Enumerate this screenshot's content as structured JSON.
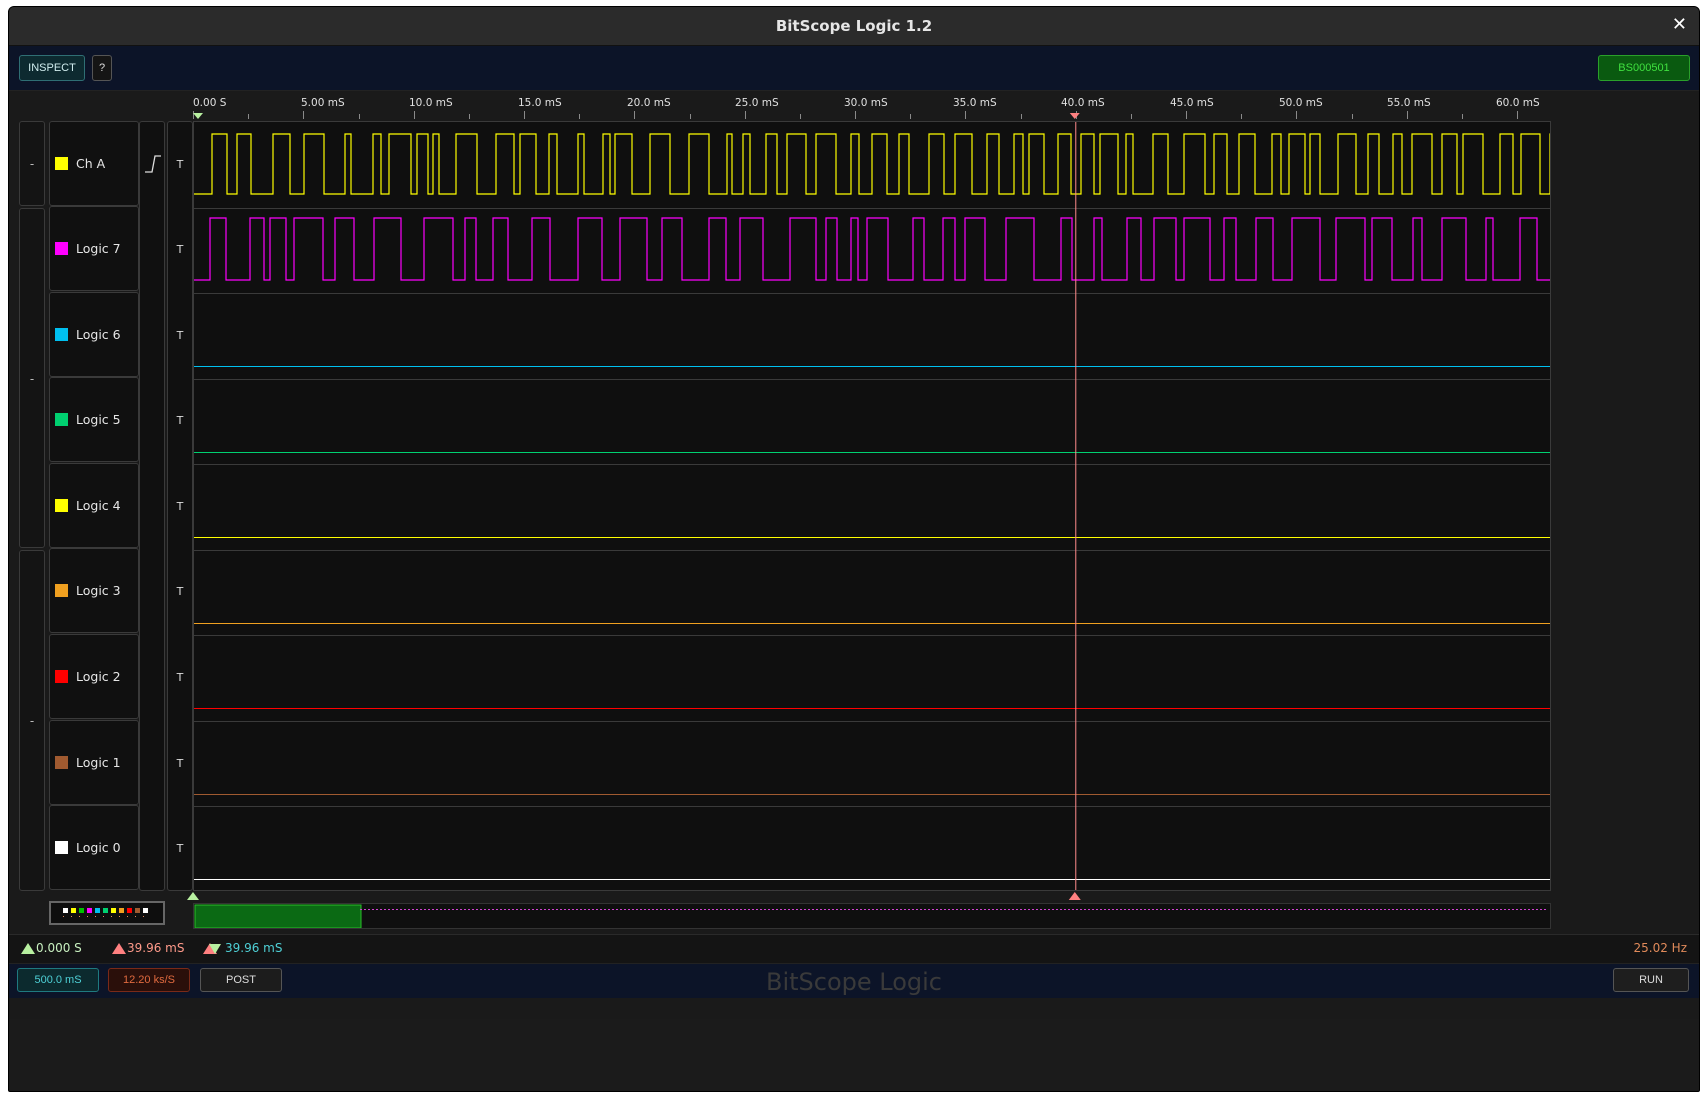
{
  "window": {
    "title": "BitScope Logic 1.2",
    "close_glyph": "✕"
  },
  "toolbar": {
    "inspect_label": "INSPECT",
    "help_label": "?",
    "device_label": "BS000501"
  },
  "ruler": {
    "ticks": [
      "0.00  S",
      "5.00 mS",
      "10.0 mS",
      "15.0 mS",
      "20.0 mS",
      "25.0 mS",
      "30.0 mS",
      "35.0 mS",
      "40.0 mS",
      "45.0 mS",
      "50.0 mS",
      "55.0 mS",
      "60.0 mS"
    ]
  },
  "groups": [
    "-",
    "-",
    "-"
  ],
  "channels": [
    {
      "name": "Ch A",
      "color": "#ffff00",
      "trigger": "T",
      "edge_icon": "rising-edge-icon"
    },
    {
      "name": "Logic 7",
      "color": "#ff00ff",
      "trigger": "T"
    },
    {
      "name": "Logic 6",
      "color": "#00c0f0",
      "trigger": "T"
    },
    {
      "name": "Logic 5",
      "color": "#00d070",
      "trigger": "T"
    },
    {
      "name": "Logic 4",
      "color": "#ffff00",
      "trigger": "T"
    },
    {
      "name": "Logic 3",
      "color": "#f0a020",
      "trigger": "T"
    },
    {
      "name": "Logic 2",
      "color": "#ff0000",
      "trigger": "T"
    },
    {
      "name": "Logic 1",
      "color": "#a05a30",
      "trigger": "T"
    },
    {
      "name": "Logic 0",
      "color": "#ffffff",
      "trigger": "T"
    }
  ],
  "markers": {
    "start_ms": 0,
    "cursor_ms": 39.96
  },
  "status": {
    "start": "0.000  S",
    "cursor": "39.96 mS",
    "delta": "39.96 mS",
    "frequency": "25.02  Hz"
  },
  "bottom": {
    "timebase": "500.0 mS",
    "sample_rate": "12.20 ks/S",
    "post_label": "POST",
    "run_label": "RUN",
    "brand": "BitScope Logic"
  }
}
